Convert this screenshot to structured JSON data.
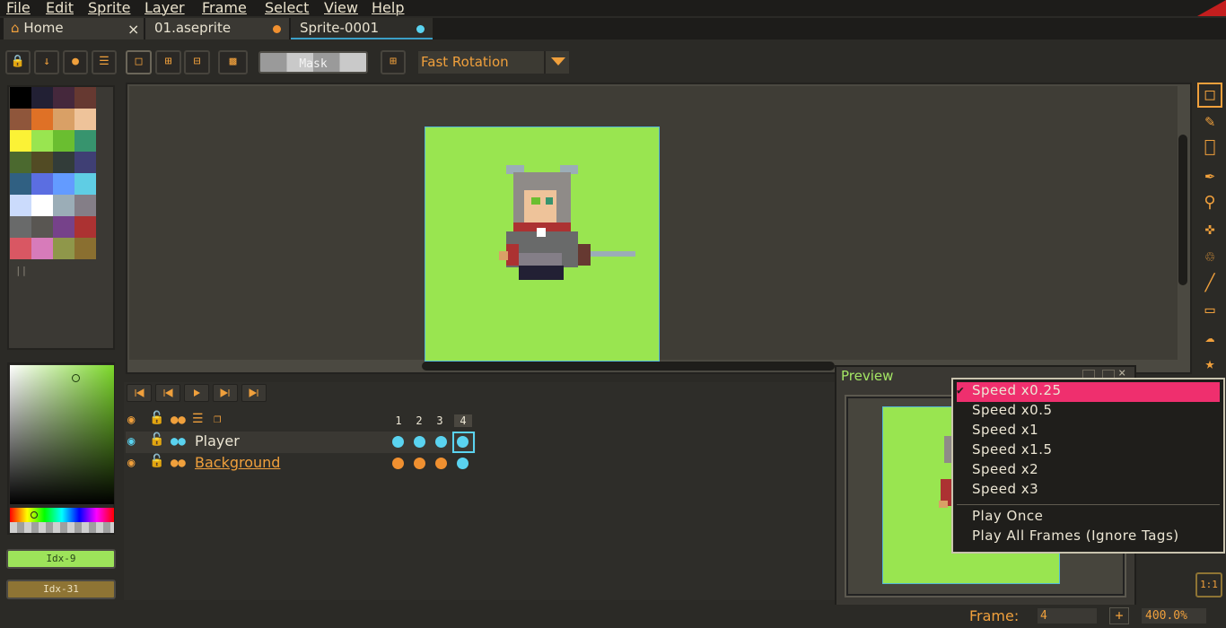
{
  "menu": [
    "File",
    "Edit",
    "Sprite",
    "Layer",
    "Frame",
    "Select",
    "View",
    "Help"
  ],
  "tabs": [
    {
      "label": "Home",
      "icon": "home-icon"
    },
    {
      "label": "01.aseprite",
      "modified": true
    },
    {
      "label": "Sprite-0001",
      "active": true
    }
  ],
  "toolbar": {
    "mask_label": "Mask",
    "rotation": "Fast Rotation"
  },
  "palette": {
    "colors": [
      "#000000",
      "#222034",
      "#45283c",
      "#663931",
      "#8f563b",
      "#df7126",
      "#d9a066",
      "#eec39a",
      "#fbf236",
      "#99e550",
      "#6abe30",
      "#37946e",
      "#4b692f",
      "#524b24",
      "#323c39",
      "#3f3f74",
      "#306082",
      "#5b6ee1",
      "#639bff",
      "#5fcde4",
      "#cbdbfc",
      "#ffffff",
      "#9badb7",
      "#847e87",
      "#696a6a",
      "#595652",
      "#76428a",
      "#ac3232",
      "#d95763",
      "#d77bba",
      "#8f974a",
      "#8a6f30"
    ]
  },
  "colors": {
    "fg_label": "Idx-9",
    "bg_label": "Idx-31",
    "fg": "#99e550",
    "bg": "#8a6f30"
  },
  "timeline": {
    "frames": [
      "1",
      "2",
      "3",
      "4"
    ],
    "layers": [
      {
        "name": "Player",
        "cel_color": "#5ad3f0"
      },
      {
        "name": "Background",
        "cel_color": "#f09030"
      }
    ]
  },
  "preview": {
    "title": "Preview"
  },
  "speed_menu": {
    "items": [
      "Speed x0.25",
      "Speed x0.5",
      "Speed x1",
      "Speed x1.5",
      "Speed x2",
      "Speed x3"
    ],
    "selected": "Speed x0.25",
    "extras": [
      "Play Once",
      "Play All Frames (Ignore Tags)"
    ]
  },
  "status": {
    "frame_label": "Frame:",
    "frame_value": "4",
    "zoom": "400.0%",
    "plus": "+",
    "zoom_button": "1:1"
  },
  "tools": [
    "marquee-icon",
    "pencil-icon",
    "eraser-icon",
    "eyedropper-icon",
    "zoom-icon",
    "move-icon",
    "fill-icon",
    "line-icon",
    "rectangle-icon",
    "blur-icon",
    "spray-icon"
  ]
}
